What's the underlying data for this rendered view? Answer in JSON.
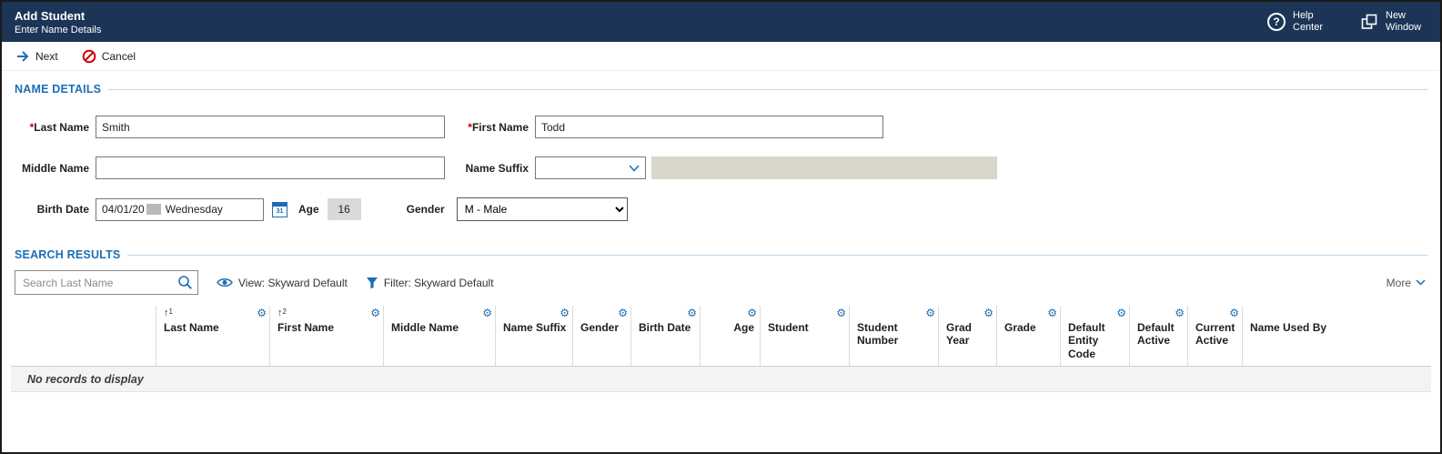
{
  "colors": {
    "header_bg": "#1c3557",
    "accent_blue": "#1b6eb5",
    "cancel_red": "#cc0000",
    "required_red": "#c00000"
  },
  "header": {
    "title": "Add Student",
    "subtitle": "Enter Name Details",
    "help_label": "Help Center",
    "new_window_label": "New Window"
  },
  "toolbar": {
    "next_label": "Next",
    "cancel_label": "Cancel"
  },
  "name_details": {
    "section_title": "NAME DETAILS",
    "last_name": {
      "required": "*",
      "label": "Last Name",
      "value": "Smith"
    },
    "first_name": {
      "required": "*",
      "label": "First Name",
      "value": "Todd"
    },
    "middle_name": {
      "label": "Middle Name",
      "value": ""
    },
    "name_suffix": {
      "label": "Name Suffix",
      "value": ""
    },
    "birth_date": {
      "label": "Birth Date",
      "value_prefix": "04/01/20",
      "value_day": "Wednesday",
      "calendar_day": "31"
    },
    "age": {
      "label": "Age",
      "value": "16"
    },
    "gender": {
      "label": "Gender",
      "value": "M - Male"
    }
  },
  "search_results": {
    "section_title": "SEARCH RESULTS",
    "search": {
      "placeholder": "Search Last Name"
    },
    "view_label": "View: Skyward Default",
    "filter_label": "Filter: Skyward Default",
    "more_label": "More",
    "columns": [
      {
        "label": "Last Name",
        "sort": "1"
      },
      {
        "label": "First Name",
        "sort": "2"
      },
      {
        "label": "Middle Name"
      },
      {
        "label": "Name Suffix"
      },
      {
        "label": "Gender"
      },
      {
        "label": "Birth Date"
      },
      {
        "label": "Age"
      },
      {
        "label": "Student"
      },
      {
        "label": "Student Number"
      },
      {
        "label": "Grad Year"
      },
      {
        "label": "Grade"
      },
      {
        "label": "Default Entity Code"
      },
      {
        "label": "Default Active"
      },
      {
        "label": "Current Active"
      },
      {
        "label": "Name Used By"
      }
    ],
    "empty_message": "No records to display"
  }
}
